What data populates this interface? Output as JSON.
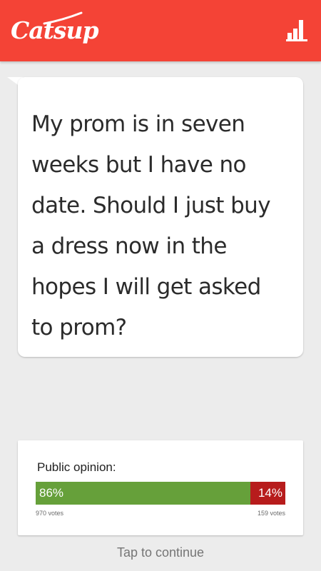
{
  "app_bar": {
    "logo_text": "Catsup",
    "background_color": "#f44336",
    "stats_icon": "bar-chart-icon"
  },
  "question": {
    "text": "My prom is in seven weeks but I have no date. Should I just buy a dress now in the hopes I will get asked to prom?"
  },
  "opinion": {
    "title": "Public opinion:",
    "yes": {
      "percent_label": "86%",
      "fraction": 0.86,
      "votes_label": "970 votes",
      "color": "#66a03a"
    },
    "no": {
      "percent_label": "14%",
      "fraction": 0.14,
      "votes_label": "159 votes",
      "color": "#b71c1c"
    }
  },
  "footer": {
    "tap_label": "Tap to continue"
  }
}
